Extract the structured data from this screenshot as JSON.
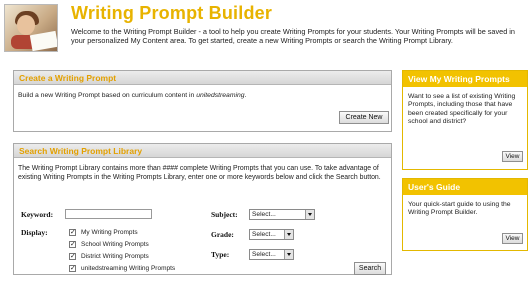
{
  "header": {
    "title": "Writing Prompt Builder",
    "intro": "Welcome to the Writing Prompt Builder - a tool to help you create Writing Prompts for your students. Your Writing Prompts will be saved in your personalized My Content area. To get started, create a new Writing Prompts or search the Writing Prompt Library."
  },
  "create": {
    "heading": "Create a Writing Prompt",
    "text": "Build a new Writing Prompt based on curriculum content in unitedstreaming.",
    "button": "Create New"
  },
  "search": {
    "heading": "Search Writing Prompt Library",
    "description": "The Writing Prompt Library contains more than #### complete Writing Prompts that you can use. To take advantage of existing Writing Prompts in the Writing Prompts Library, enter one or more keywords below and click the Search button.",
    "keyword_label": "Keyword:",
    "keyword_value": "",
    "display_label": "Display:",
    "options": [
      {
        "label": "My Writing Prompts",
        "checked": true
      },
      {
        "label": "School Writing Prompts",
        "checked": true
      },
      {
        "label": "District Writing Prompts",
        "checked": true
      },
      {
        "label": "unitedstreaming Writing Prompts",
        "checked": true
      }
    ],
    "subject_label": "Subject:",
    "subject_value": "Select...",
    "grade_label": "Grade:",
    "grade_value": "Select...",
    "type_label": "Type:",
    "type_value": "Select...",
    "button": "Search"
  },
  "sidebar": {
    "view_prompts": {
      "heading": "View My Writing Prompts",
      "text": "Want to see a list of existing Writing Prompts, including those that have been created specifically for your school and district?",
      "button": "View"
    },
    "users_guide": {
      "heading": "User's Guide",
      "text": "Your quick-start guide to using the Writing Prompt Builder.",
      "button": "View"
    }
  },
  "colors": {
    "accent": "#e8b300",
    "sidebar_header": "#f2c200"
  }
}
